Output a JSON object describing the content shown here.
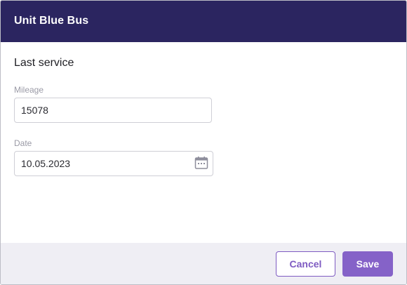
{
  "dialog": {
    "title": "Unit Blue Bus"
  },
  "section": {
    "title": "Last service"
  },
  "fields": {
    "mileage": {
      "label": "Mileage",
      "value": "15078"
    },
    "date": {
      "label": "Date",
      "value": "10.05.2023",
      "icon": "calendar-icon"
    }
  },
  "footer": {
    "cancel_label": "Cancel",
    "save_label": "Save"
  },
  "colors": {
    "header_bg": "#2b2560",
    "accent": "#8562c8",
    "footer_bg": "#efeef4"
  }
}
